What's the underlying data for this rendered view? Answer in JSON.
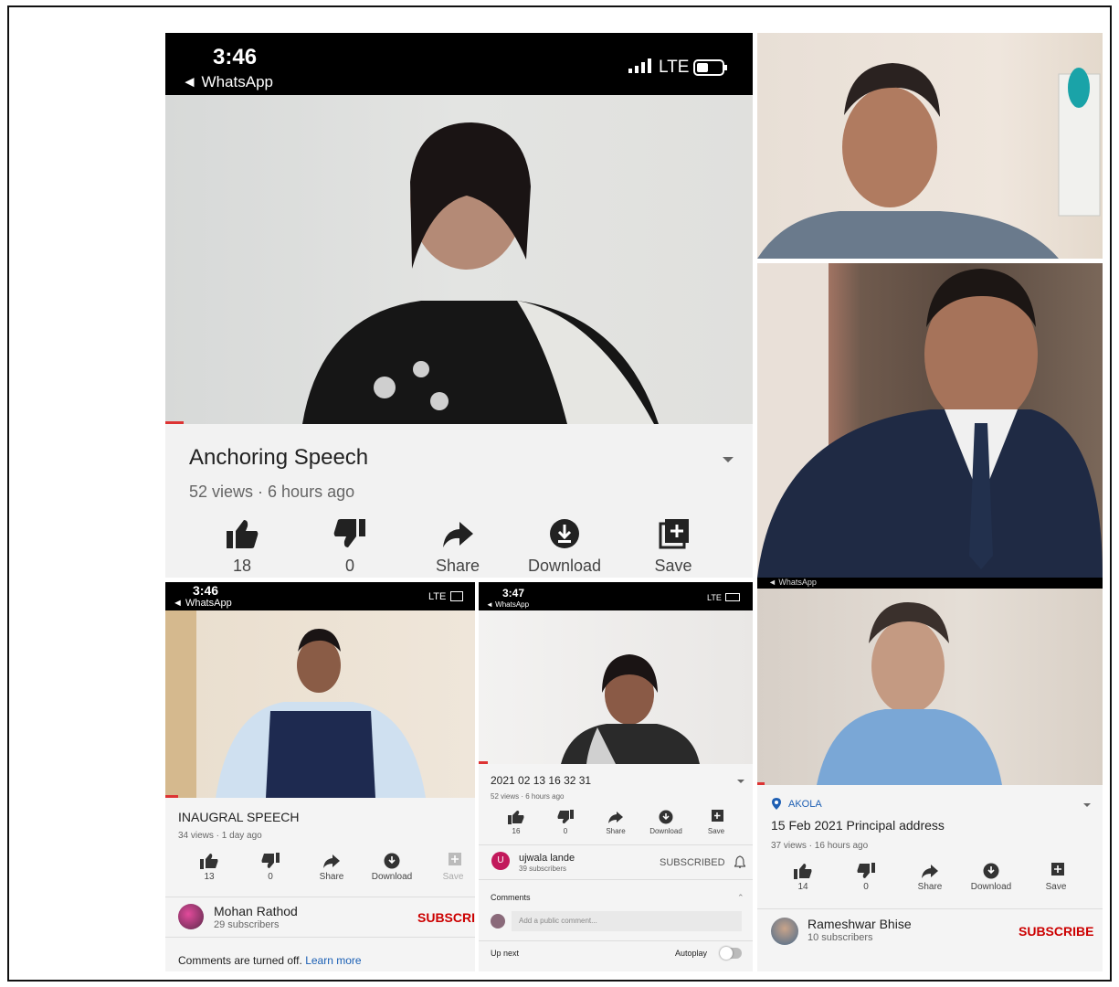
{
  "main": {
    "status": {
      "time": "3:46",
      "back": "◄ WhatsApp",
      "network": "LTE"
    },
    "title": "Anchoring Speech",
    "meta": "52 views · 6 hours ago",
    "likes": "18",
    "dislikes": "0",
    "share": "Share",
    "download": "Download",
    "save": "Save"
  },
  "bl": {
    "status": {
      "time": "3:46",
      "back": "◄ WhatsApp",
      "network": "LTE"
    },
    "title": "INAUGRAL SPEECH",
    "meta": "34 views · 1 day ago",
    "likes": "13",
    "dislikes": "0",
    "share": "Share",
    "download": "Download",
    "save": "Save",
    "channel": "Mohan Rathod",
    "subs": "29 subscribers",
    "subscribe": "SUBSCRIBE",
    "comments_off": "Comments are turned off.",
    "learn_more": "Learn more"
  },
  "bm": {
    "status": {
      "time": "3:47",
      "back": "◄ WhatsApp",
      "network": "LTE"
    },
    "title": "2021 02 13 16 32 31",
    "meta": "52 views · 6 hours ago",
    "likes": "16",
    "dislikes": "0",
    "share": "Share",
    "download": "Download",
    "save": "Save",
    "avatar_letter": "U",
    "channel": "ujwala lande",
    "subs": "39 subscribers",
    "subscribed": "SUBSCRIBED",
    "comments_label": "Comments",
    "comment_placeholder": "Add a public comment...",
    "up_next": "Up next",
    "autoplay": "Autoplay"
  },
  "br": {
    "status": {
      "back": "◄ WhatsApp"
    },
    "location": "AKOLA",
    "title": "15 Feb 2021 Principal address",
    "meta": "37 views · 16 hours ago",
    "likes": "14",
    "dislikes": "0",
    "share": "Share",
    "download": "Download",
    "save": "Save",
    "channel": "Rameshwar Bhise",
    "subs": "10 subscribers",
    "subscribe": "SUBSCRIBE"
  },
  "colors": {
    "accent_red": "#cc0000",
    "progress": "#dd3333",
    "panel": "#f2f2f2"
  },
  "icons": [
    "like-icon",
    "dislike-icon",
    "share-icon",
    "download-icon",
    "save-icon",
    "bell-icon",
    "location-icon",
    "signal-icon",
    "battery-icon"
  ]
}
